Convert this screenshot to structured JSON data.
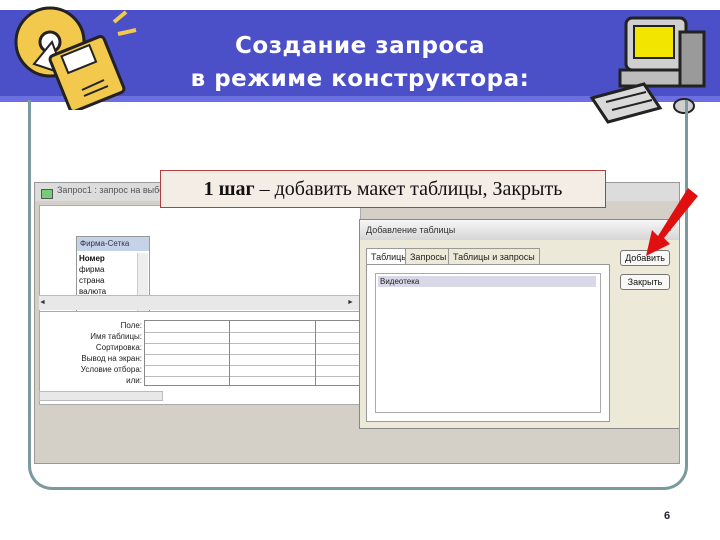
{
  "slide": {
    "title_line1": "Создание запроса",
    "title_line2": "в режиме конструктора:",
    "page_number": "6",
    "colors": {
      "header": "#4b4fc8",
      "frame": "#7b9aa0",
      "callout_border": "#b04040",
      "arrow": "#e01010"
    }
  },
  "callout": {
    "step_bold": "1 шаг",
    "step_text": " – добавить макет таблицы, Закрыть"
  },
  "screenshot": {
    "window_title": "Запрос1 : запрос на выборку",
    "table_list": {
      "title": "Фирма-Сетка",
      "items": [
        "Номер",
        "фирма",
        "страна",
        "валюта"
      ]
    },
    "grid_labels": [
      "Поле:",
      "Имя таблицы:",
      "Сортировка:",
      "Вывод на экран:",
      "Условие отбора:",
      "или:"
    ],
    "dialog": {
      "title": "Добавление таблицы",
      "tabs": [
        "Таблицы",
        "Запросы",
        "Таблицы и запросы"
      ],
      "list_items": [
        "Видеотека"
      ],
      "add_button": "Добавить",
      "close_button": "Закрыть"
    }
  },
  "icons": {
    "disc": "disc-clipart-icon",
    "computer": "computer-clipart-icon",
    "arrow": "red-arrow-icon"
  }
}
